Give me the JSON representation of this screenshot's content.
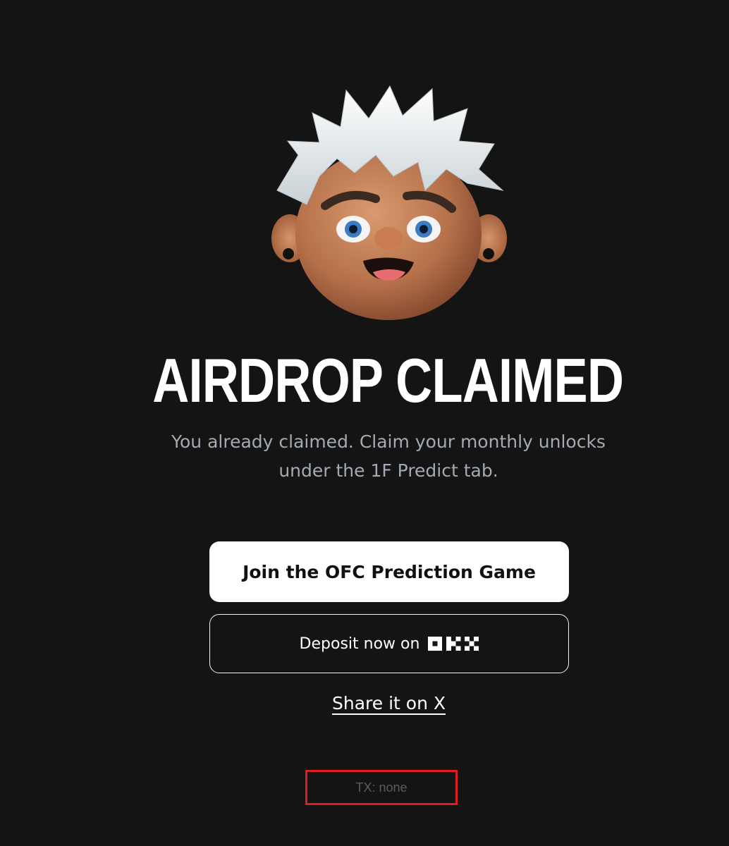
{
  "hero": {
    "avatar_icon": "cartoon-avatar-white-hair",
    "title": "AIRDROP CLAIMED",
    "subtitle_line1": "You already claimed. Claim your monthly unlocks",
    "subtitle_line2": "under the 1F Predict tab."
  },
  "actions": {
    "primary_label": "Join the OFC Prediction Game",
    "secondary_label": "Deposit now on",
    "secondary_logo": "okx-logo",
    "share_label": "Share it on X"
  },
  "footer": {
    "tx_text": "TX: none"
  },
  "colors": {
    "background": "#141414",
    "primary_button_bg": "#ffffff",
    "subtitle_text": "#a3aab4",
    "highlight_border": "#e21c1c",
    "tx_text": "#5c5c5c"
  }
}
